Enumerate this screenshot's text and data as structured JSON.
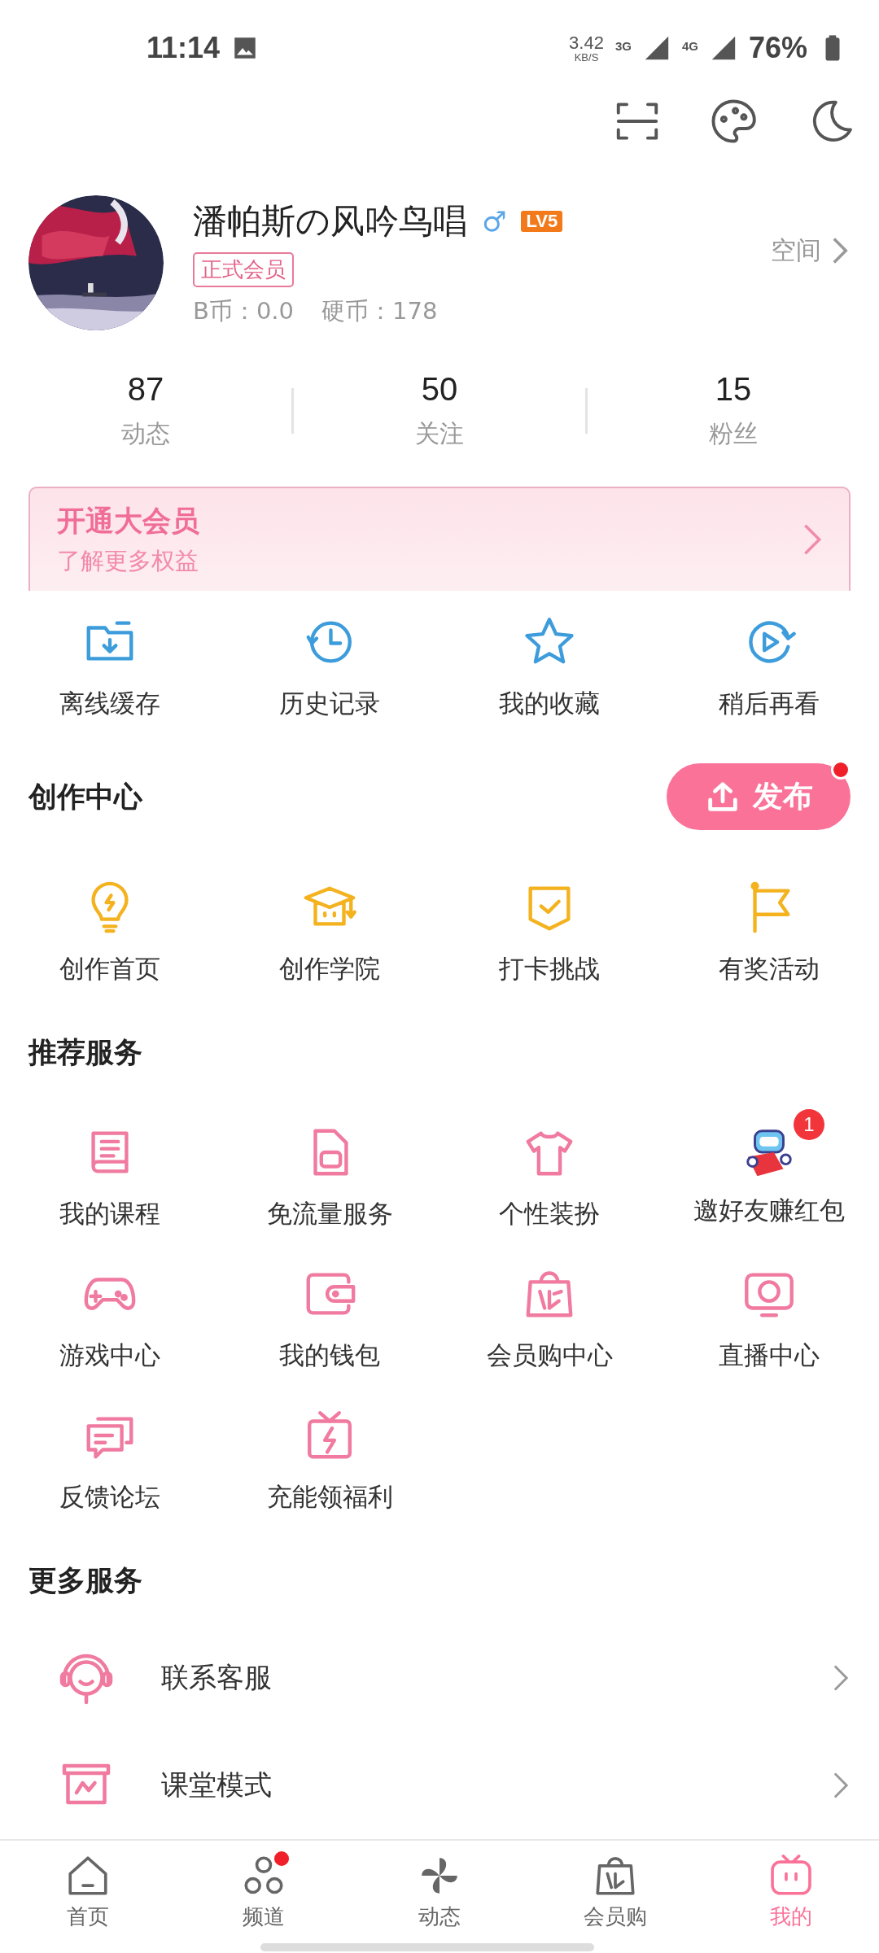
{
  "status_bar": {
    "time": "11:14",
    "speed": "3.42",
    "speed_unit": "KB/S",
    "net1": "3G",
    "net2": "4G",
    "battery": "76%"
  },
  "profile": {
    "name": "潘帕斯の风吟鸟唱",
    "gender": "♂",
    "level": "LV5",
    "member_tag": "正式会员",
    "coins": "B币：0.0",
    "hard_coins": "硬币：178",
    "space_link": "空间"
  },
  "stats": [
    {
      "value": "87",
      "label": "动态"
    },
    {
      "value": "50",
      "label": "关注"
    },
    {
      "value": "15",
      "label": "粉丝"
    }
  ],
  "vip_banner": {
    "title": "开通大会员",
    "subtitle": "了解更多权益"
  },
  "quick_actions": [
    "离线缓存",
    "历史记录",
    "我的收藏",
    "稍后再看"
  ],
  "creator_center": {
    "title": "创作中心",
    "publish_button": {
      "label": "发布",
      "dot": true
    },
    "items": [
      "创作首页",
      "创作学院",
      "打卡挑战",
      "有奖活动"
    ]
  },
  "recommended": {
    "title": "推荐服务",
    "items": [
      {
        "label": "我的课程"
      },
      {
        "label": "免流量服务"
      },
      {
        "label": "个性装扮"
      },
      {
        "label": "邀好友赚红包",
        "badge": "1"
      },
      {
        "label": "游戏中心"
      },
      {
        "label": "我的钱包"
      },
      {
        "label": "会员购中心"
      },
      {
        "label": "直播中心"
      },
      {
        "label": "反馈论坛"
      },
      {
        "label": "充能领福利"
      }
    ]
  },
  "more_services": {
    "title": "更多服务",
    "items": [
      "联系客服",
      "课堂模式"
    ]
  },
  "bottom_nav": [
    {
      "label": "首页",
      "selected": false,
      "dot": false
    },
    {
      "label": "频道",
      "selected": false,
      "dot": true
    },
    {
      "label": "动态",
      "selected": false,
      "dot": false
    },
    {
      "label": "会员购",
      "selected": false,
      "dot": false
    },
    {
      "label": "我的",
      "selected": true,
      "dot": false
    }
  ]
}
